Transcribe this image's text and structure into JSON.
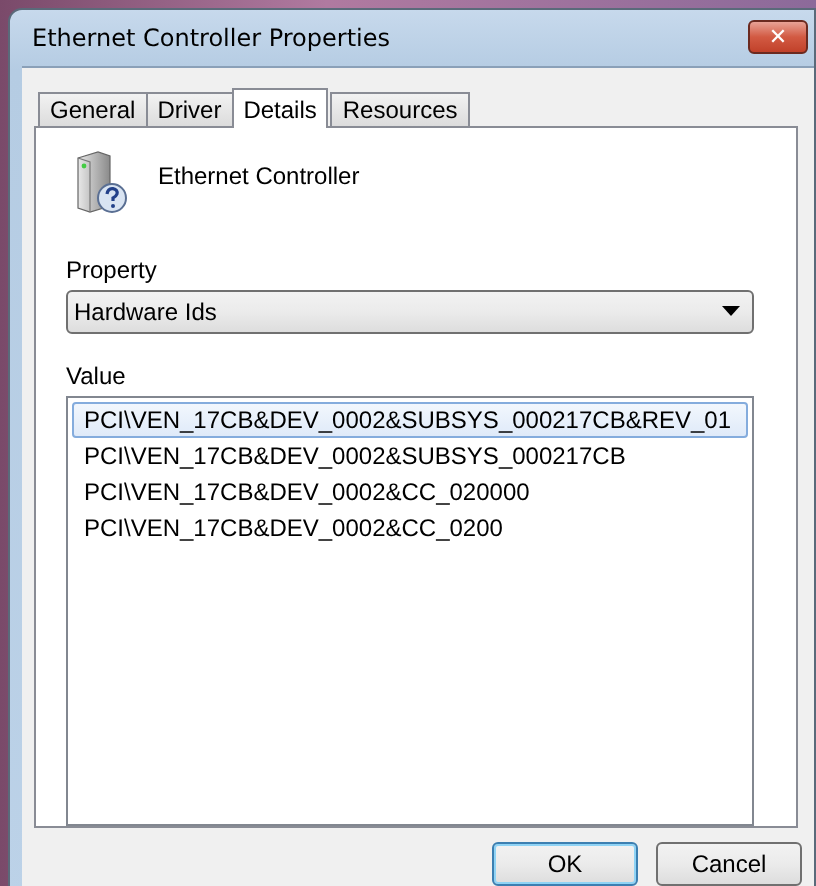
{
  "window": {
    "title": "Ethernet Controller Properties",
    "close": "✕"
  },
  "tabs": [
    {
      "label": "General",
      "selected": false
    },
    {
      "label": "Driver",
      "selected": false
    },
    {
      "label": "Details",
      "selected": true
    },
    {
      "label": "Resources",
      "selected": false
    }
  ],
  "device": {
    "name": "Ethernet Controller"
  },
  "property": {
    "label": "Property",
    "value": "Hardware Ids"
  },
  "value_list": {
    "label": "Value",
    "items": [
      {
        "text": "PCI\\VEN_17CB&DEV_0002&SUBSYS_000217CB&REV_01",
        "selected": true
      },
      {
        "text": "PCI\\VEN_17CB&DEV_0002&SUBSYS_000217CB",
        "selected": false
      },
      {
        "text": "PCI\\VEN_17CB&DEV_0002&CC_020000",
        "selected": false
      },
      {
        "text": "PCI\\VEN_17CB&DEV_0002&CC_0200",
        "selected": false
      }
    ]
  },
  "buttons": [
    "OK",
    "Cancel"
  ]
}
